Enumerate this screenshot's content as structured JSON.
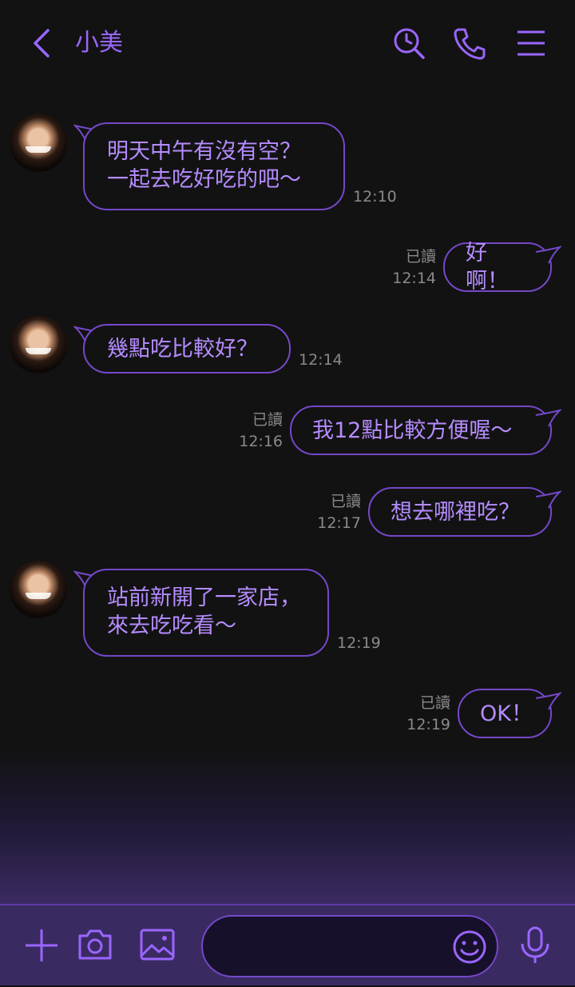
{
  "header": {
    "contact_name": "小美",
    "back_icon": "chevron-left-icon",
    "search_icon": "search-clock-icon",
    "call_icon": "phone-icon",
    "menu_icon": "hamburger-menu-icon"
  },
  "colors": {
    "accent": "#9a66ff",
    "bubble_border": "#7448c8",
    "bubble_text": "#b58cff",
    "background": "#121212"
  },
  "messages": [
    {
      "side": "left",
      "text": "明天中午有沒有空？\n一起去吃好吃的吧～",
      "time": "12:10"
    },
    {
      "side": "right",
      "text": "好啊！",
      "read": "已讀",
      "time": "12:14"
    },
    {
      "side": "left",
      "text": "幾點吃比較好？",
      "time": "12:14"
    },
    {
      "side": "right",
      "text": "我12點比較方便喔～",
      "read": "已讀",
      "time": "12:16"
    },
    {
      "side": "right",
      "text": "想去哪裡吃？",
      "read": "已讀",
      "time": "12:17"
    },
    {
      "side": "left",
      "text": "站前新開了一家店，\n來去吃吃看～",
      "time": "12:19"
    },
    {
      "side": "right",
      "text": "OK！",
      "read": "已讀",
      "time": "12:19"
    }
  ],
  "composer": {
    "placeholder": "",
    "plus_icon": "plus-icon",
    "camera_icon": "camera-icon",
    "image_icon": "image-icon",
    "emoji_icon": "emoji-icon",
    "mic_icon": "microphone-icon"
  }
}
